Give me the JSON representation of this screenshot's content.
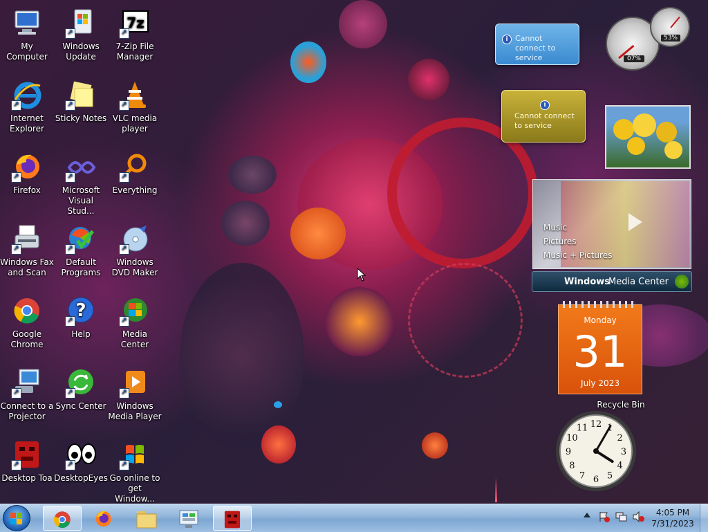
{
  "desktop_icons": [
    {
      "label": "My Computer",
      "icon": "computer-icon"
    },
    {
      "label": "Windows Update",
      "icon": "windows-update-icon"
    },
    {
      "label": "7-Zip File Manager",
      "icon": "7zip-icon"
    },
    {
      "label": "Internet Explorer",
      "icon": "internet-explorer-icon"
    },
    {
      "label": "Sticky Notes",
      "icon": "sticky-notes-icon"
    },
    {
      "label": "VLC media player",
      "icon": "vlc-icon"
    },
    {
      "label": "Firefox",
      "icon": "firefox-icon"
    },
    {
      "label": "Microsoft Visual Stud...",
      "icon": "visual-studio-icon"
    },
    {
      "label": "Everything",
      "icon": "everything-icon"
    },
    {
      "label": "Windows Fax and Scan",
      "icon": "fax-icon"
    },
    {
      "label": "Default Programs",
      "icon": "default-programs-icon"
    },
    {
      "label": "Windows DVD Maker",
      "icon": "dvd-maker-icon"
    },
    {
      "label": "Google Chrome",
      "icon": "chrome-icon"
    },
    {
      "label": "Help",
      "icon": "help-icon"
    },
    {
      "label": "Media Center",
      "icon": "media-center-icon"
    },
    {
      "label": "Connect to a Projector",
      "icon": "projector-icon"
    },
    {
      "label": "Sync Center",
      "icon": "sync-center-icon"
    },
    {
      "label": "Windows Media Player",
      "icon": "media-player-icon"
    },
    {
      "label": "Desktop Toa",
      "icon": "desktop-toa-icon"
    },
    {
      "label": "DesktopEyes",
      "icon": "desktop-eyes-icon"
    },
    {
      "label": "Go online to get Window...",
      "icon": "windows-flag-icon"
    }
  ],
  "recycle_bin": {
    "label": "Recycle Bin"
  },
  "gadgets": {
    "weather_msg": "Cannot connect to service",
    "currency_msg": "Cannot connect to service",
    "cpu": {
      "cpu_percent": "07%",
      "memory_percent": "53%"
    },
    "media_center": {
      "items": [
        "Music",
        "Pictures",
        "Music + Pictures"
      ],
      "footer_brand": "Windows",
      "footer_product": "Media Center"
    },
    "calendar": {
      "weekday": "Monday",
      "day": "31",
      "month_year": "July 2023"
    },
    "clock": {
      "numerals": [
        "12",
        "1",
        "2",
        "3",
        "4",
        "5",
        "6",
        "7",
        "8",
        "9",
        "10",
        "11"
      ],
      "hour": 4,
      "minute": 5
    }
  },
  "taskbar": {
    "items": [
      "start-orb",
      "google-chrome",
      "firefox",
      "windows-explorer",
      "control-panel",
      "desktop-toa"
    ],
    "time": "4:05 PM",
    "date": "7/31/2023"
  },
  "colors": {
    "taskbar": "#8fb4da",
    "calendar": "#e8600e",
    "accent_pink": "#d63a7a"
  }
}
